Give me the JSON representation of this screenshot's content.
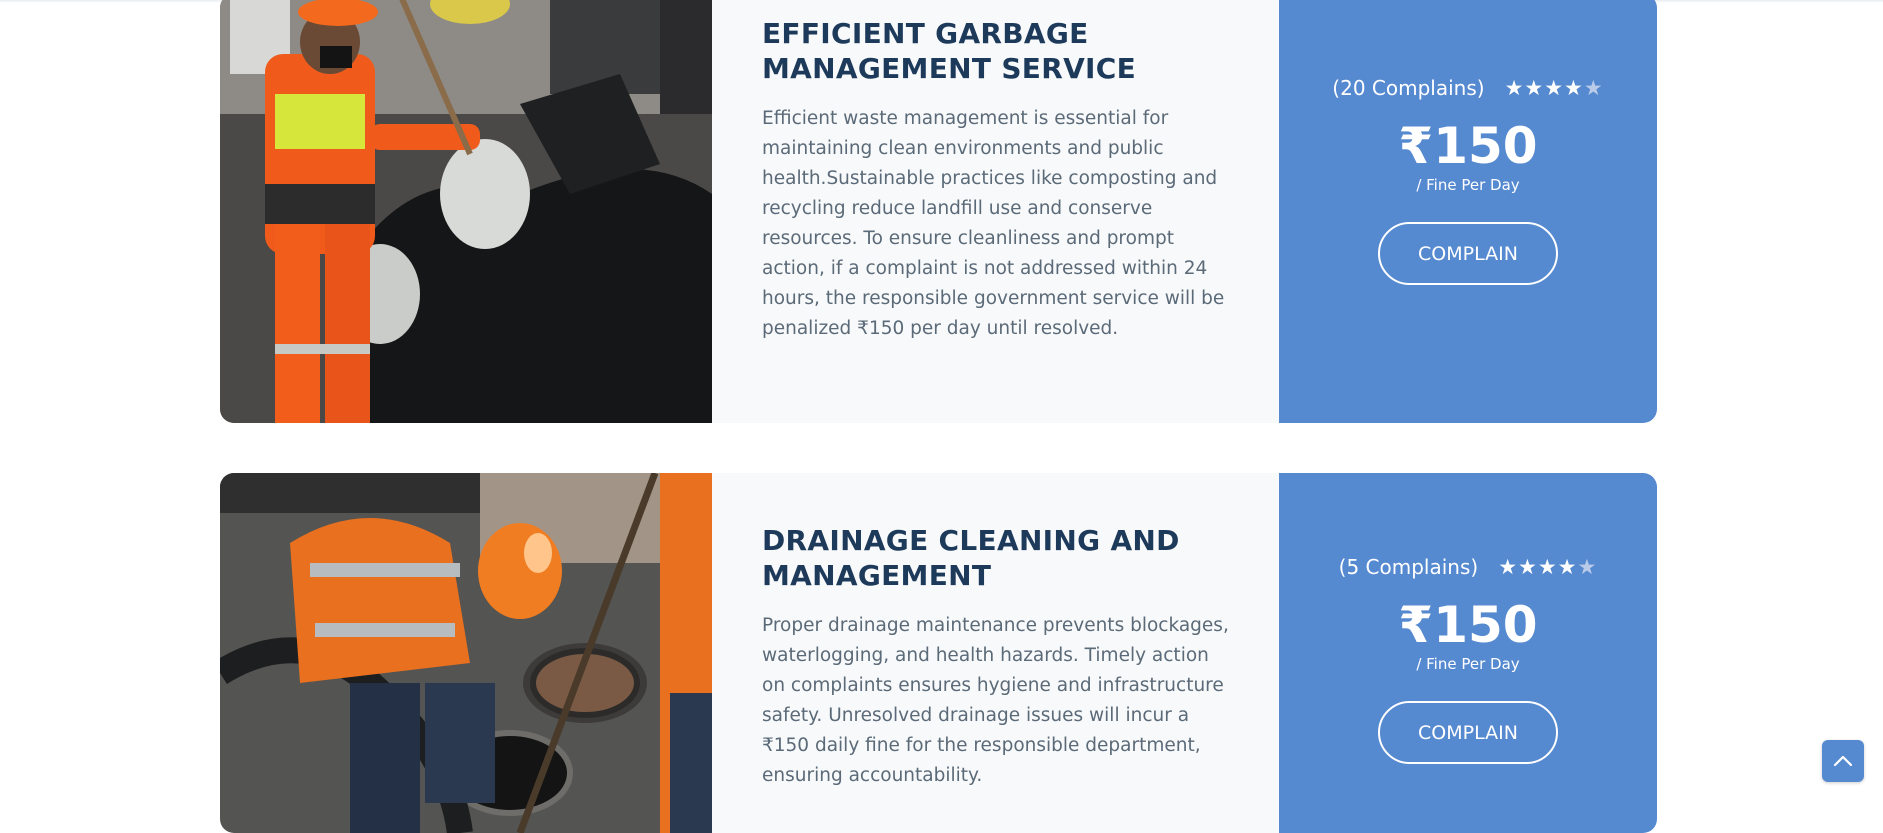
{
  "services": [
    {
      "title": "EFFICIENT GARBAGE MANAGEMENT SERVICE",
      "description": "Efficient waste management is essential for maintaining clean environments and public health.Sustainable practices like composting and recycling reduce landfill use and conserve resources. To ensure cleanliness and prompt action, if a complaint is not addressed within 24 hours, the responsible government service will be penalized ₹150 per day until resolved.",
      "complaints": "(20 Complains)",
      "rating": 4,
      "rating_max": 5,
      "price": "₹150",
      "price_unit": "/ Fine Per Day",
      "button_label": "COMPLAIN",
      "image": "garbage-worker-photo"
    },
    {
      "title": "DRAINAGE CLEANING AND MANAGEMENT",
      "description": "Proper drainage maintenance prevents blockages, waterlogging, and health hazards. Timely action on complaints ensures hygiene and infrastructure safety. Unresolved drainage issues will incur a ₹150 daily fine for the responsible department, ensuring accountability.",
      "complaints": "(5 Complains)",
      "rating": 4,
      "rating_max": 5,
      "price": "₹150",
      "price_unit": "/ Fine Per Day",
      "button_label": "COMPLAIN",
      "image": "drainage-worker-photo"
    }
  ],
  "back_to_top_icon": "chevron-up-icon",
  "colors": {
    "accent": "#5589d0",
    "title": "#1d3a5b",
    "text": "#5b6a78"
  }
}
